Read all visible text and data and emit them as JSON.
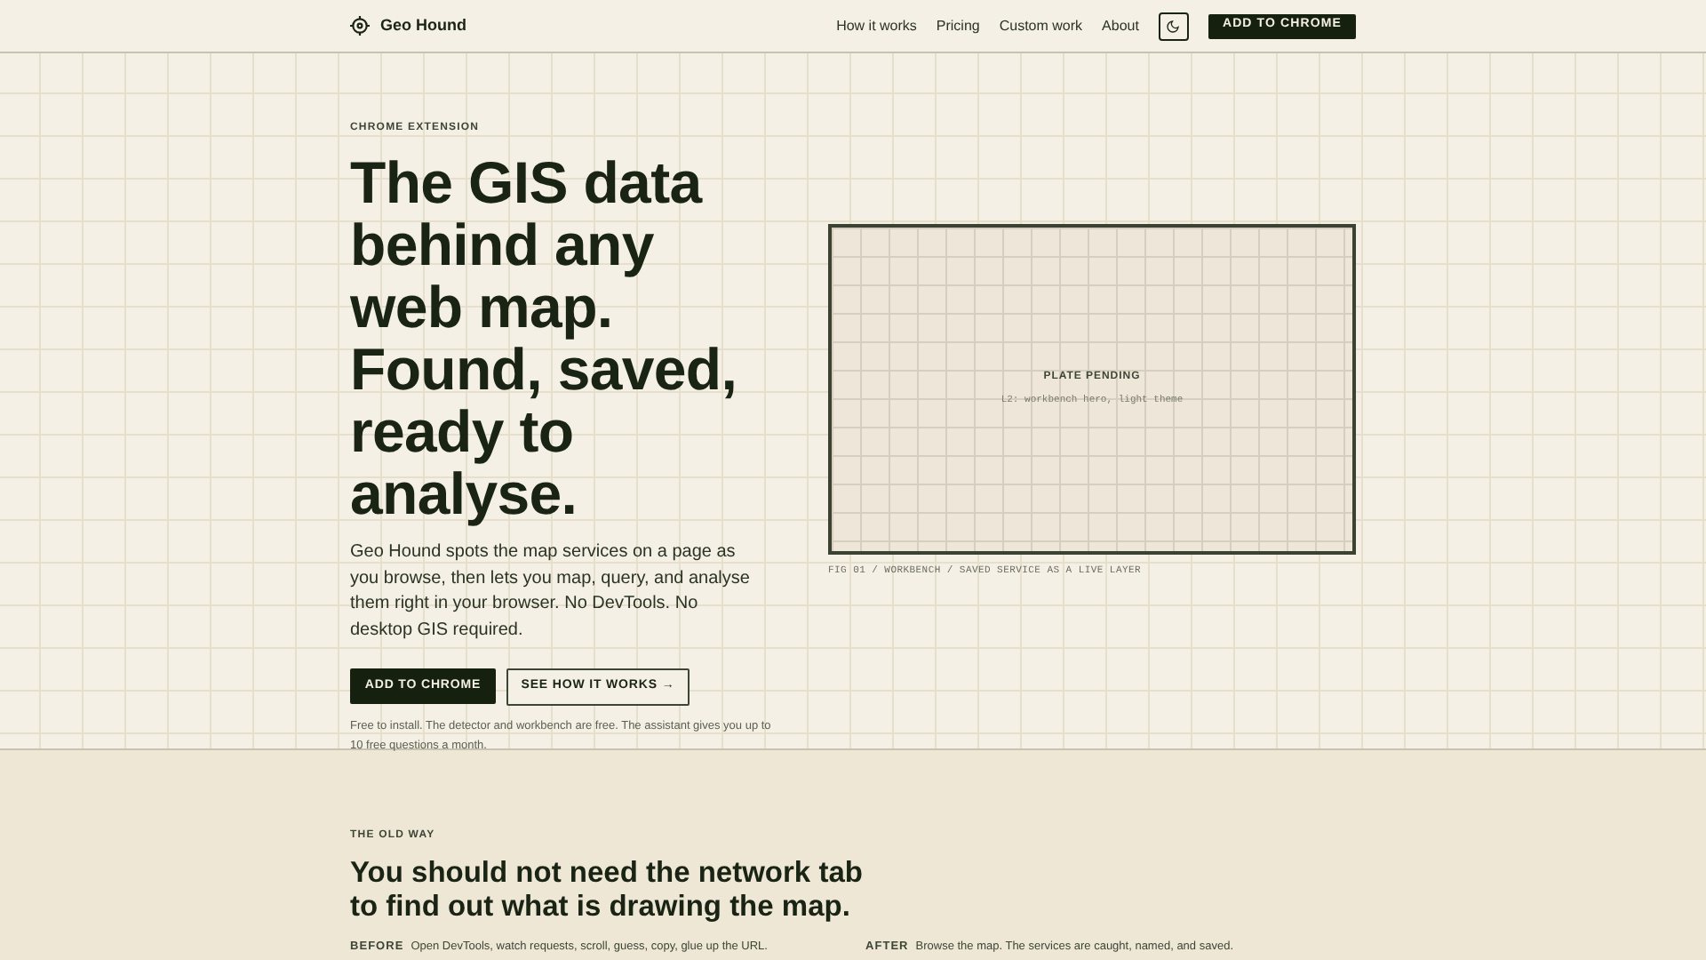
{
  "brand": {
    "name": "Geo Hound"
  },
  "nav": {
    "links": [
      "How it works",
      "Pricing",
      "Custom work",
      "About"
    ],
    "cta": "ADD TO CHROME"
  },
  "hero": {
    "eyebrow": "CHROME EXTENSION",
    "headline": "The GIS data behind any web map. Found, saved, ready to analyse.",
    "body": "Geo Hound spots the map services on a page as you browse, then lets you map, query, and analyse them right in your browser. No DevTools. No desktop GIS required.",
    "primary_button": "ADD TO CHROME",
    "secondary_button": "SEE HOW IT WORKS",
    "secondary_arrow": "→",
    "note": "Free to install. The detector and workbench are free. The assistant gives you up to 10 free questions a month."
  },
  "plate": {
    "title": "PLATE PENDING",
    "subtitle": "L2: workbench hero, light theme",
    "caption": "FIG 01 / WORKBENCH / SAVED SERVICE AS A LIVE LAYER"
  },
  "old_way": {
    "eyebrow": "THE OLD WAY",
    "heading": "You should not need the network tab to find out what is drawing the map.",
    "columns": [
      {
        "label": "BEFORE",
        "text": "Open DevTools, watch requests, scroll, guess, copy, glue up the URL."
      },
      {
        "label": "AFTER",
        "text": "Browse the map. The services are caught, named, and saved."
      }
    ]
  }
}
